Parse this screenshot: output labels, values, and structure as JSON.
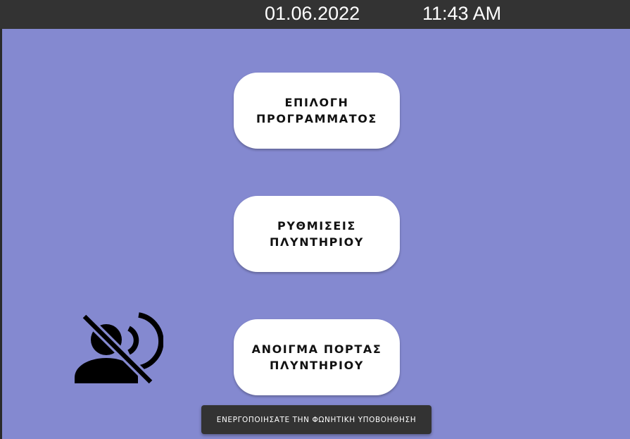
{
  "status_bar": {
    "date": "01.06.2022",
    "time": "11:43 AM"
  },
  "menu": {
    "program_label": "ΕΠΙΛΟΓΗ\nΠΡΟΓΡΑΜΜΑΤΟΣ",
    "settings_label": "ΡΥΘΜΙΣΕΙΣ\nΠΛΥΝΤΗΡΙΟΥ",
    "door_label": "ΑΝΟΙΓΜΑ ΠΟΡΤΑΣ\nΠΛΥΝΤΗΡΙΟΥ"
  },
  "voice_assistant": {
    "icon": "voice-over-off-icon",
    "state": "off"
  },
  "toast": {
    "message": "ΕΝΕΡΓΟΠΟΙΗΣΑΤΕ ΤΗΝ ΦΩΝΗΤΙΚΗ ΥΠΟΒΟΗΘΗΣΗ"
  },
  "colors": {
    "background": "#8489d0",
    "status_bar": "#333333",
    "button": "#ffffff",
    "toast": "#333333"
  }
}
